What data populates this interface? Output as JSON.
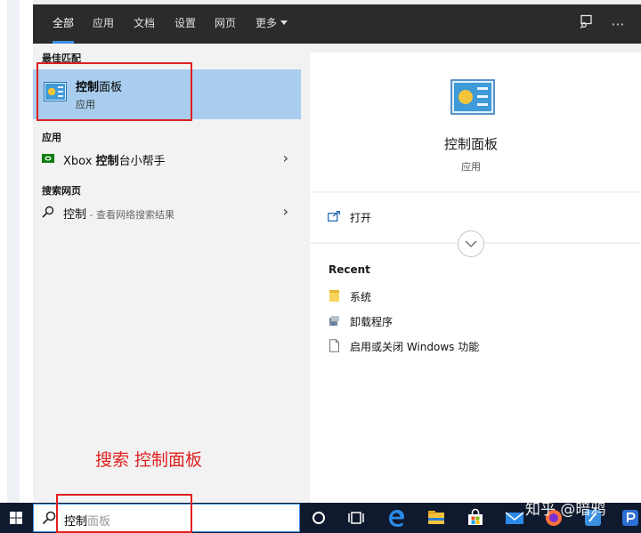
{
  "tabs": [
    {
      "label": "全部"
    },
    {
      "label": "应用"
    },
    {
      "label": "文档"
    },
    {
      "label": "设置"
    },
    {
      "label": "网页"
    },
    {
      "label": "更多"
    }
  ],
  "sections": {
    "best_match": "最佳匹配",
    "apps": "应用",
    "web": "搜索网页"
  },
  "best_match": {
    "title_bold": "控制",
    "title_rest": "面板",
    "subtitle": "应用"
  },
  "app_result": {
    "prefix": "Xbox ",
    "bold": "控制",
    "rest": "台小帮手"
  },
  "web_result": {
    "query": "控制",
    "hint": " - 查看网络搜索结果"
  },
  "preview": {
    "title": "控制面板",
    "subtitle": "应用",
    "action_open": "打开",
    "recent_header": "Recent",
    "recent_items": [
      {
        "label": "系统"
      },
      {
        "label": "卸载程序"
      },
      {
        "label": "启用或关闭 Windows 功能"
      }
    ]
  },
  "annotation": "搜索 控制面板",
  "search": {
    "typed": "控制",
    "suggestion": "面板"
  },
  "watermark": "知乎 @暗鸦",
  "colors": {
    "topbar": "#2b2b2b",
    "selection": "#a9cdee",
    "accent": "#3a8fe0",
    "annotation": "#e02020",
    "taskbar": "#101a2e"
  }
}
